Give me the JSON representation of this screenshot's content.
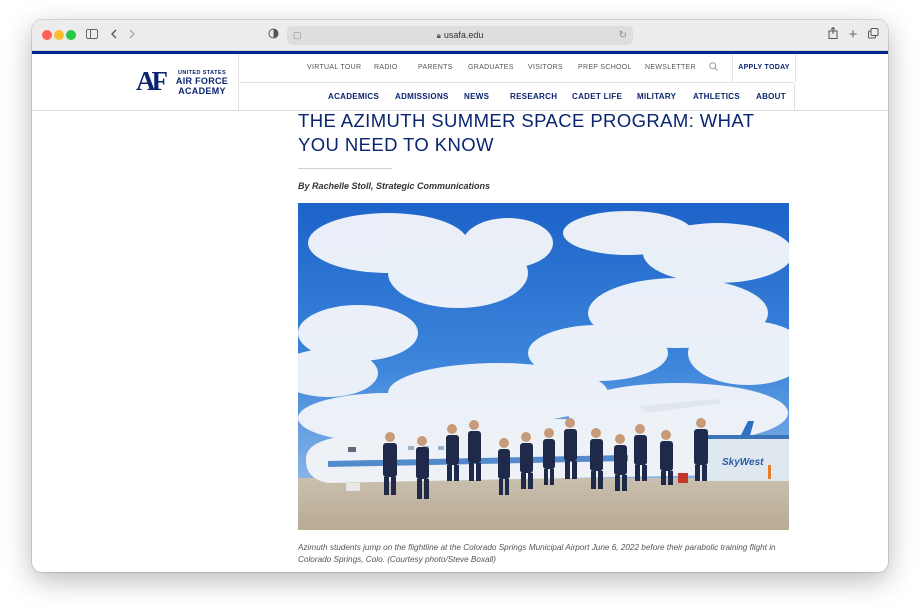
{
  "browser": {
    "url": "usafa.edu"
  },
  "site": {
    "logo": {
      "monogram": "AF",
      "line1": "UNITED STATES",
      "line2": "AIR FORCE",
      "line3": "ACADEMY"
    },
    "utility_nav": [
      "VIRTUAL TOUR",
      "RADIO",
      "PARENTS",
      "GRADUATES",
      "VISITORS",
      "PREP SCHOOL",
      "NEWSLETTER"
    ],
    "apply_label": "APPLY TODAY",
    "main_nav": [
      "ACADEMICS",
      "ADMISSIONS",
      "NEWS",
      "RESEARCH",
      "CADET LIFE",
      "MILITARY",
      "ATHLETICS",
      "ABOUT"
    ]
  },
  "article": {
    "title": "THE AZIMUTH SUMMER SPACE PROGRAM: WHAT YOU NEED TO KNOW",
    "byline": "By Rachelle Stoll, Strategic Communications",
    "caption": "Azimuth students jump on the flightline at the Colorado Springs Municipal Airport June 6, 2022 before their parabolic training flight in Colorado Springs, Colo. (Courtesy photo/Steve Boxall)",
    "photo_plane_text": "SkyWest"
  },
  "colors": {
    "brand_navy": "#0a2470",
    "rule_blue": "#00278c"
  }
}
